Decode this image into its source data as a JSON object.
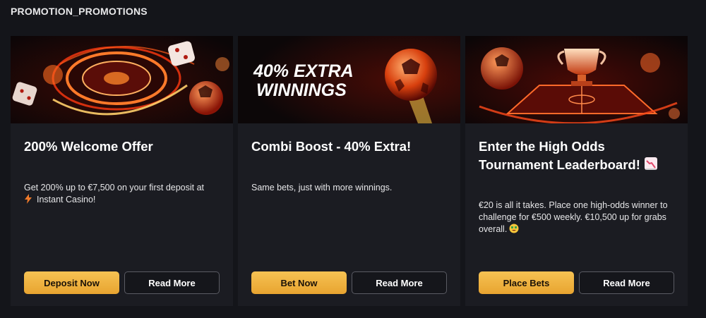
{
  "section_title": "PROMOTION_PROMOTIONS",
  "cards": [
    {
      "title": "200% Welcome Offer",
      "desc_line1": "Get 200% up to €7,500 on your first deposit at",
      "desc_line2": "Instant Casino!",
      "primary_label": "Deposit Now",
      "secondary_label": "Read More"
    },
    {
      "banner_line1": "40% EXTRA",
      "banner_line2": "WINNINGS",
      "title": "Combi Boost - 40% Extra!",
      "desc": "Same bets, just with more winnings.",
      "primary_label": "Bet Now",
      "secondary_label": "Read More"
    },
    {
      "title_line1": "Enter the High Odds",
      "title_line2": "Tournament Leaderboard!",
      "desc": "€20 is all it takes. Place one high-odds winner to challenge for €500 weekly. €10,500 up for grabs overall.",
      "primary_label": "Place Bets",
      "secondary_label": "Read More"
    }
  ],
  "colors": {
    "background": "#14151a",
    "card": "#1b1c22",
    "accent_button": "#f2b541",
    "secondary_border": "#5a5b63"
  },
  "icons": [
    "lightning-icon",
    "chart-decreasing-icon",
    "money-face-emoji"
  ]
}
